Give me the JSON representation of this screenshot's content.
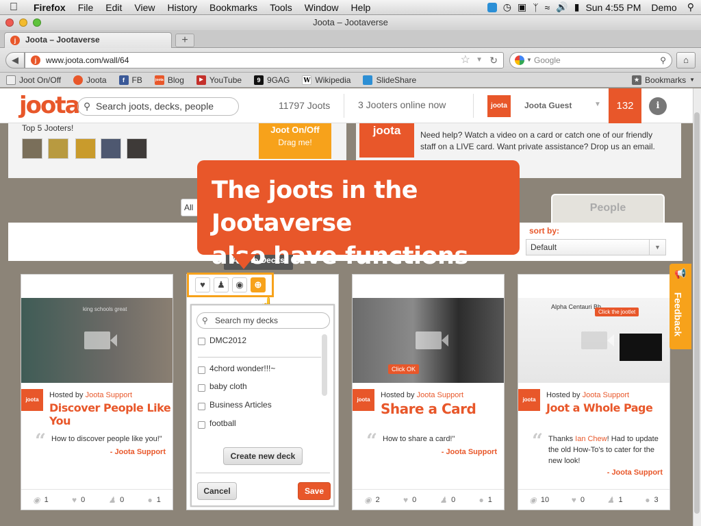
{
  "menubar": {
    "app": "Firefox",
    "items": [
      "File",
      "Edit",
      "View",
      "History",
      "Bookmarks",
      "Tools",
      "Window",
      "Help"
    ],
    "clock": "Sun 4:55 PM",
    "user": "Demo"
  },
  "window": {
    "title": "Joota – Jootaverse"
  },
  "tab": {
    "label": "Joota – Jootaverse",
    "new_tab": "+"
  },
  "nav": {
    "url": "www.joota.com/wall/64",
    "search_placeholder": "Google"
  },
  "bookmarks_bar": {
    "items": [
      "Joot On/Off",
      "Joota",
      "FB",
      "Blog",
      "YouTube",
      "9GAG",
      "Wikipedia",
      "SlideShare"
    ],
    "menu": "Bookmarks"
  },
  "site": {
    "logo": "joota",
    "search_placeholder": "Search joots, decks, people",
    "joots_count": "11797 Joots",
    "online": "3 Jooters online now",
    "user_logo": "joota",
    "user_name": "Joota Guest",
    "notifications": "132",
    "info": "i"
  },
  "top_panel": {
    "top5_label": "Top 5 Jooters!",
    "joot_btn_line1": "Joot On/Off",
    "joot_btn_line2": "Drag me!",
    "help_logo": "joota",
    "help_text": "Need help? Watch a video on a card or catch one of our friendly staff on a LIVE card. Want private assistance? Drop us an email."
  },
  "tabs": {
    "all_partial": "All c",
    "s_partial": "s",
    "people": "People"
  },
  "sort": {
    "label": "sort by:",
    "value": "Default"
  },
  "callout": {
    "line1": "The joots in the Jootaverse",
    "line2": "also have functions"
  },
  "add_to_decks": "Add to Decks",
  "deck_popup": {
    "search_placeholder": "Search my decks",
    "decks": [
      "DMC2012",
      "4chord wonder!!!~",
      "baby cloth",
      "Business Articles",
      "football"
    ],
    "create_btn": "Create new deck",
    "cancel_btn": "Cancel",
    "save_btn": "Save"
  },
  "cards": [
    {
      "hosted_by": "Hosted by",
      "host": "Joota Support",
      "title": "Discover People Like You",
      "quote": "How to discover people like you!\"",
      "author": "- Joota Support",
      "stats": {
        "views": "1",
        "likes": "0",
        "people": "0",
        "comments": "1"
      },
      "img_text": "king schools great"
    },
    {
      "hosted_by": "Hosted by",
      "host": "Joota Support",
      "title": "Share a Card",
      "quote": "How to share a card!\"",
      "author": "- Joota Support",
      "stats": {
        "views": "2",
        "likes": "0",
        "people": "0",
        "comments": "1"
      },
      "img_text": "Click OK"
    },
    {
      "hosted_by": "Hosted by",
      "host": "Joota Support",
      "title": "Joot a Whole Page",
      "quote_pre": "Thanks ",
      "quote_name": "Ian Chew",
      "quote_post": "! Had to update the old How-To's to cater for the new look!",
      "author": "- Joota Support",
      "stats": {
        "views": "10",
        "likes": "0",
        "people": "1",
        "comments": "3"
      },
      "img_text": "Click the jootlet",
      "img_title": "Alpha Centauri Bb"
    }
  ],
  "feedback": "Feedback",
  "colors": {
    "brand": "#e8572a",
    "accent": "#f7a21b",
    "background": "#8c8478"
  }
}
